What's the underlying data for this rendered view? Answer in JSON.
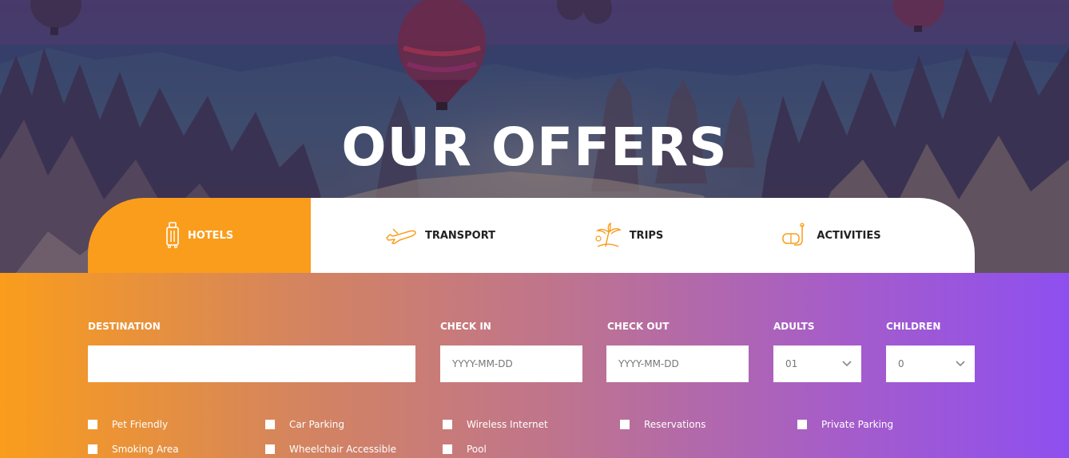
{
  "hero": {
    "title": "OUR OFFERS"
  },
  "tabs": [
    {
      "label": "HOTELS",
      "icon": "luggage-icon",
      "active": true
    },
    {
      "label": "TRANSPORT",
      "icon": "airplane-icon",
      "active": false
    },
    {
      "label": "TRIPS",
      "icon": "palm-tree-icon",
      "active": false
    },
    {
      "label": "ACTIVITIES",
      "icon": "snorkel-icon",
      "active": false
    }
  ],
  "form": {
    "destination": {
      "label": "DESTINATION",
      "value": ""
    },
    "check_in": {
      "label": "CHECK IN",
      "placeholder": "YYYY-MM-DD"
    },
    "check_out": {
      "label": "CHECK OUT",
      "placeholder": "YYYY-MM-DD"
    },
    "adults": {
      "label": "ADULTS",
      "value": "01"
    },
    "children": {
      "label": "CHILDREN",
      "value": "0"
    }
  },
  "amenities": [
    "Pet Friendly",
    "Car Parking",
    "Wireless Internet",
    "Reservations",
    "Private Parking",
    "Smoking Area",
    "Wheelchair Accessible",
    "Pool"
  ],
  "colors": {
    "accent_orange": "#fa9d1c",
    "accent_purple": "#8e4ff0",
    "tab_text": "#222222"
  }
}
